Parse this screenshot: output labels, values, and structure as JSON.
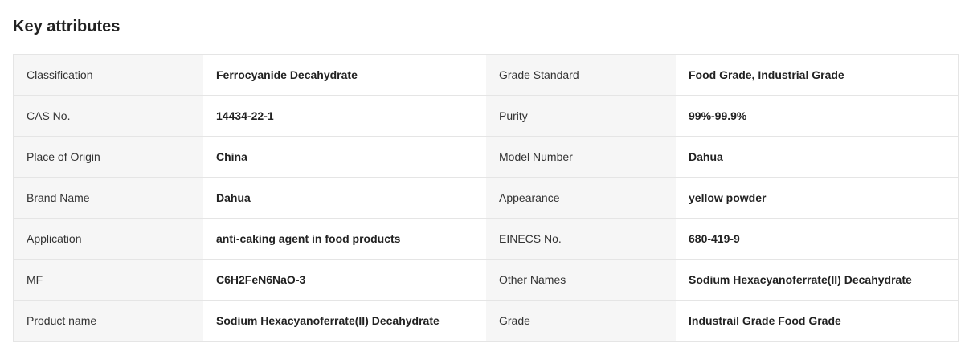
{
  "section": {
    "title": "Key attributes"
  },
  "attributes": [
    {
      "left_label": "Classification",
      "left_value": "Ferrocyanide Decahydrate",
      "right_label": "Grade Standard",
      "right_value": "Food Grade, Industrial Grade"
    },
    {
      "left_label": "CAS No.",
      "left_value": "14434-22-1",
      "right_label": "Purity",
      "right_value": "99%-99.9%"
    },
    {
      "left_label": "Place of Origin",
      "left_value": "China",
      "right_label": "Model Number",
      "right_value": "Dahua"
    },
    {
      "left_label": "Brand Name",
      "left_value": "Dahua",
      "right_label": "Appearance",
      "right_value": "yellow powder"
    },
    {
      "left_label": "Application",
      "left_value": "anti-caking agent in food products",
      "right_label": "EINECS No.",
      "right_value": "680-419-9"
    },
    {
      "left_label": "MF",
      "left_value": "C6H2FeN6NaO-3",
      "right_label": "Other Names",
      "right_value": "Sodium Hexacyanoferrate(II) Decahydrate"
    },
    {
      "left_label": "Product name",
      "left_value": "Sodium Hexacyanoferrate(II) Decahydrate",
      "right_label": "Grade",
      "right_value": "Industrail Grade Food Grade"
    }
  ]
}
